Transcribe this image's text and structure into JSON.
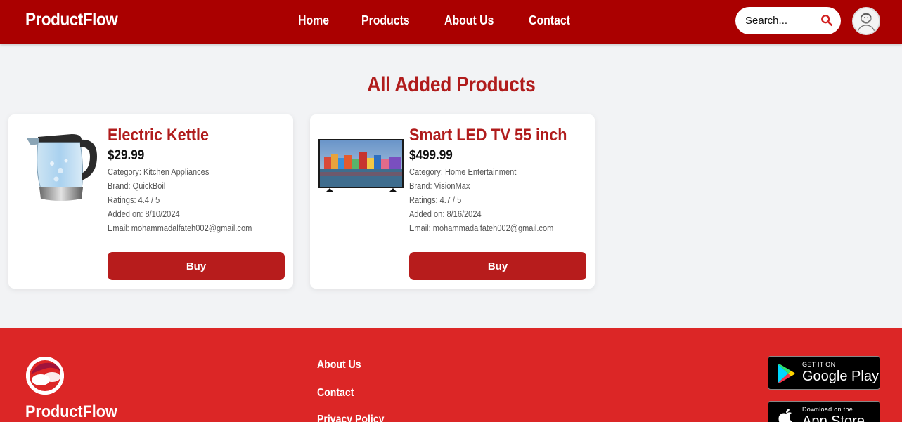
{
  "header": {
    "brand": "ProductFlow",
    "nav": [
      "Home",
      "Products",
      "About Us",
      "Contact"
    ],
    "search_placeholder": "Search..."
  },
  "page": {
    "title": "All Added Products"
  },
  "products": [
    {
      "name": "Electric Kettle",
      "price": "$29.99",
      "category": "Category: Kitchen Appliances",
      "brand": "Brand: QuickBoil",
      "ratings": "Ratings: 4.4 / 5",
      "added": "Added on: 8/10/2024",
      "email": "Email: mohammadalfateh002@gmail.com",
      "buy_label": "Buy",
      "image_icon": "kettle-image"
    },
    {
      "name": "Smart LED TV 55 inch",
      "price": "$499.99",
      "category": "Category: Home Entertainment",
      "brand": "Brand: VisionMax",
      "ratings": "Ratings: 4.7 / 5",
      "added": "Added on: 8/16/2024",
      "email": "Email: mohammadalfateh002@gmail.com",
      "buy_label": "Buy",
      "image_icon": "tv-image"
    }
  ],
  "footer": {
    "brand": "ProductFlow",
    "links": [
      "About Us",
      "Contact",
      "Privacy Policy"
    ],
    "google_play": {
      "small": "GET IT ON",
      "big": "Google Play"
    },
    "app_store": {
      "small": "Download on the",
      "big": "App Store"
    }
  },
  "colors": {
    "nav_bg": "#aa0000",
    "accent": "#b01c1c",
    "button": "#b71c1c",
    "footer_bg": "#dc2626",
    "page_bg": "#f2f3f5"
  }
}
